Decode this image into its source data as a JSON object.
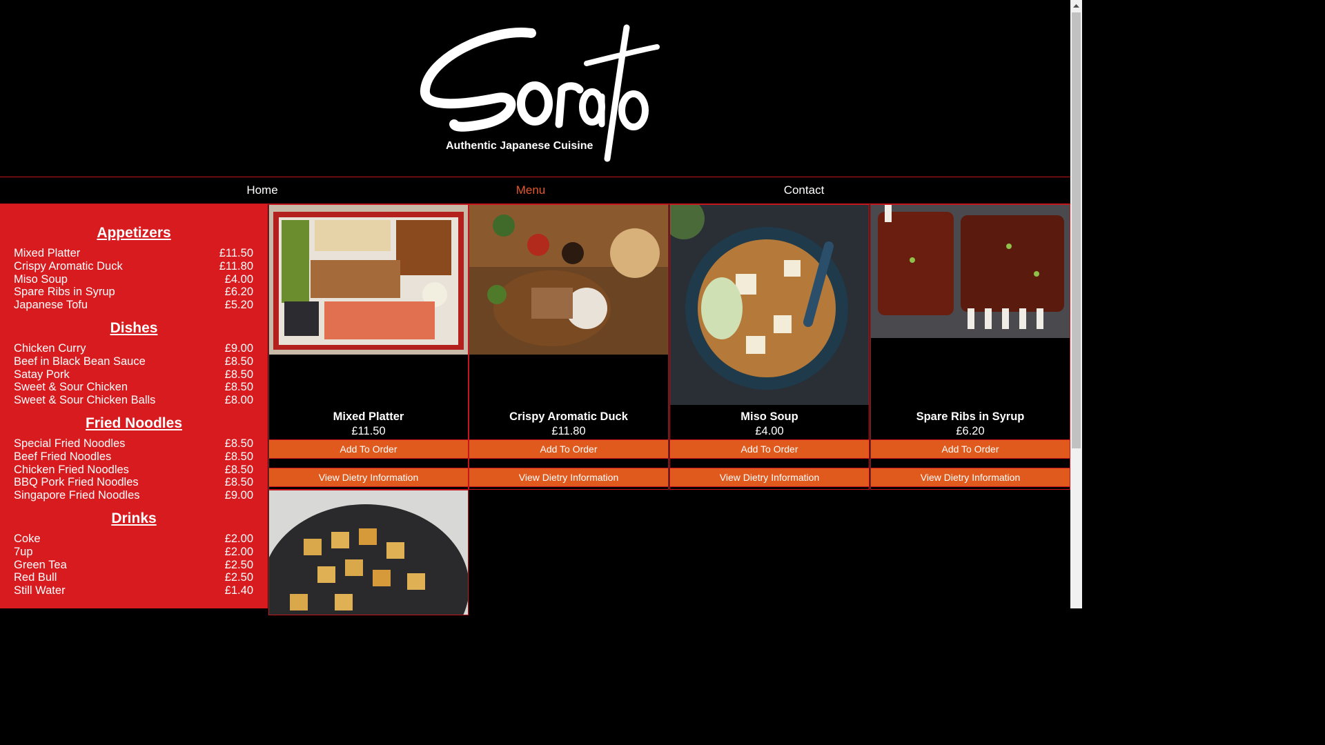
{
  "brand": {
    "logo_text": "Sorato",
    "tagline": "Authentic Japanese Cuisine"
  },
  "nav": {
    "items": [
      "Home",
      "Menu",
      "Contact"
    ],
    "active": "Menu"
  },
  "menu": {
    "sections": [
      {
        "title": "Appetizers",
        "items": [
          {
            "name": "Mixed Platter",
            "price": "£11.50"
          },
          {
            "name": "Crispy Aromatic Duck",
            "price": "£11.80"
          },
          {
            "name": "Miso Soup",
            "price": "£4.00"
          },
          {
            "name": "Spare Ribs in Syrup",
            "price": "£6.20"
          },
          {
            "name": "Japanese Tofu",
            "price": "£5.20"
          }
        ]
      },
      {
        "title": "Dishes",
        "items": [
          {
            "name": "Chicken Curry",
            "price": "£9.00"
          },
          {
            "name": "Beef in Black Bean Sauce",
            "price": "£8.50"
          },
          {
            "name": "Satay Pork",
            "price": "£8.50"
          },
          {
            "name": "Sweet & Sour Chicken",
            "price": "£8.50"
          },
          {
            "name": "Sweet & Sour Chicken Balls",
            "price": "£8.00"
          }
        ]
      },
      {
        "title": "Fried Noodles",
        "items": [
          {
            "name": "Special Fried Noodles",
            "price": "£8.50"
          },
          {
            "name": "Beef Fried Noodles",
            "price": "£8.50"
          },
          {
            "name": "Chicken Fried Noodles",
            "price": "£8.50"
          },
          {
            "name": "BBQ Pork Fried Noodles",
            "price": "£8.50"
          },
          {
            "name": "Singapore Fried Noodles",
            "price": "£9.00"
          }
        ]
      },
      {
        "title": "Drinks",
        "items": [
          {
            "name": "Coke",
            "price": "£2.00"
          },
          {
            "name": "7up",
            "price": "£2.00"
          },
          {
            "name": "Green Tea",
            "price": "£2.50"
          },
          {
            "name": "Red Bull",
            "price": "£2.50"
          },
          {
            "name": "Still Water",
            "price": "£1.40"
          }
        ]
      }
    ]
  },
  "cards": [
    {
      "name": "Mixed Platter",
      "price": "£11.50",
      "add_label": "Add To Order",
      "diet_label": "View Dietry Information"
    },
    {
      "name": "Crispy Aromatic Duck",
      "price": "£11.80",
      "add_label": "Add To Order",
      "diet_label": "View Dietry Information"
    },
    {
      "name": "Miso Soup",
      "price": "£4.00",
      "add_label": "Add To Order",
      "diet_label": "View Dietry Information"
    },
    {
      "name": "Spare Ribs in Syrup",
      "price": "£6.20",
      "add_label": "Add To Order",
      "diet_label": "View Dietry Information"
    }
  ],
  "colors": {
    "accent_red": "#d81b1f",
    "button_orange": "#e05a1e",
    "active_nav": "#e4572e",
    "background": "#000000"
  }
}
